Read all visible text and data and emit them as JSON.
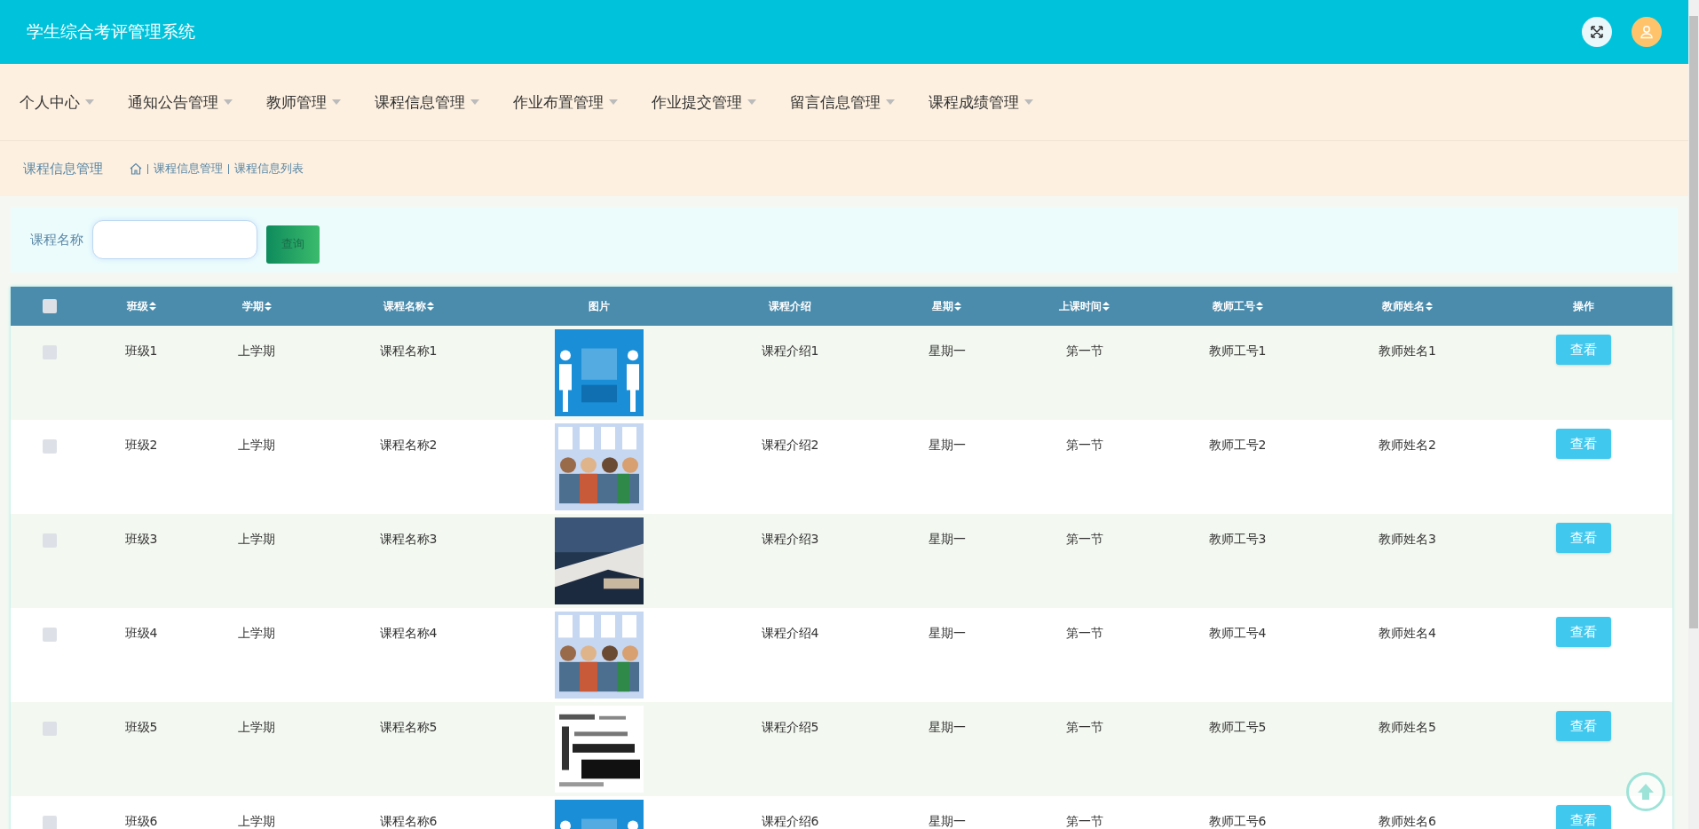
{
  "header": {
    "title": "学生综合考评管理系统"
  },
  "nav": [
    {
      "label": "个人中心"
    },
    {
      "label": "通知公告管理"
    },
    {
      "label": "教师管理"
    },
    {
      "label": "课程信息管理"
    },
    {
      "label": "作业布置管理"
    },
    {
      "label": "作业提交管理"
    },
    {
      "label": "留言信息管理"
    },
    {
      "label": "课程成绩管理"
    }
  ],
  "breadcrumb": {
    "page_title": "课程信息管理",
    "crumbs": [
      "课程信息管理",
      "课程信息列表"
    ]
  },
  "search": {
    "label": "课程名称",
    "button": "查询"
  },
  "table": {
    "select_all": {
      "checked": false
    },
    "columns": [
      {
        "label": "班级",
        "sortable": true
      },
      {
        "label": "学期",
        "sortable": true
      },
      {
        "label": "课程名称",
        "sortable": true
      },
      {
        "label": "图片",
        "sortable": false
      },
      {
        "label": "课程介绍",
        "sortable": false
      },
      {
        "label": "星期",
        "sortable": true
      },
      {
        "label": "上课时间",
        "sortable": true
      },
      {
        "label": "教师工号",
        "sortable": true
      },
      {
        "label": "教师姓名",
        "sortable": true
      },
      {
        "label": "操作",
        "sortable": false
      }
    ],
    "rows": [
      {
        "checked": false,
        "cells": [
          "班级1",
          "上学期",
          "课程名称1",
          {
            "kind": "picture"
          },
          "课程介绍1",
          "星期一",
          "第一节",
          "教师工号1",
          "教师姓名1",
          {
            "kind": "button",
            "label": "查看"
          }
        ]
      },
      {
        "checked": false,
        "cells": [
          "班级2",
          "上学期",
          "课程名称2",
          {
            "kind": "picture"
          },
          "课程介绍2",
          "星期一",
          "第一节",
          "教师工号2",
          "教师姓名2",
          {
            "kind": "button",
            "label": "查看"
          }
        ]
      },
      {
        "checked": false,
        "cells": [
          "班级3",
          "上学期",
          "课程名称3",
          {
            "kind": "picture"
          },
          "课程介绍3",
          "星期一",
          "第一节",
          "教师工号3",
          "教师姓名3",
          {
            "kind": "button",
            "label": "查看"
          }
        ]
      },
      {
        "checked": false,
        "cells": [
          "班级4",
          "上学期",
          "课程名称4",
          {
            "kind": "picture"
          },
          "课程介绍4",
          "星期一",
          "第一节",
          "教师工号4",
          "教师姓名4",
          {
            "kind": "button",
            "label": "查看"
          }
        ]
      },
      {
        "checked": false,
        "cells": [
          "班级5",
          "上学期",
          "课程名称5",
          {
            "kind": "picture"
          },
          "课程介绍5",
          "星期一",
          "第一节",
          "教师工号5",
          "教师姓名5",
          {
            "kind": "button",
            "label": "查看"
          }
        ]
      },
      {
        "checked": false,
        "cells": [
          "班级6",
          "上学期",
          "课程名称6",
          {
            "kind": "picture"
          },
          "课程介绍6",
          "星期一",
          "第一节",
          "教师工号6",
          "教师姓名6",
          {
            "kind": "button",
            "label": "查看"
          }
        ]
      }
    ]
  }
}
